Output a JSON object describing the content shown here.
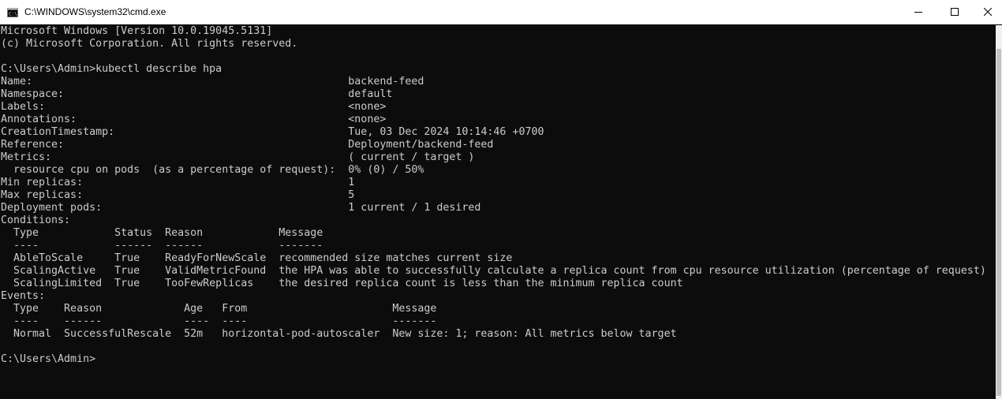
{
  "window": {
    "title": "C:\\WINDOWS\\system32\\cmd.exe",
    "app_icon": "cmd-icon",
    "controls": {
      "minimize_icon": "minimize-icon",
      "maximize_icon": "maximize-icon",
      "close_icon": "close-icon"
    }
  },
  "console": {
    "lines": [
      "Microsoft Windows [Version 10.0.19045.5131]",
      "(c) Microsoft Corporation. All rights reserved.",
      "",
      "C:\\Users\\Admin>kubectl describe hpa",
      "Name:                                                  backend-feed",
      "Namespace:                                             default",
      "Labels:                                                <none>",
      "Annotations:                                           <none>",
      "CreationTimestamp:                                     Tue, 03 Dec 2024 10:14:46 +0700",
      "Reference:                                             Deployment/backend-feed",
      "Metrics:                                               ( current / target )",
      "  resource cpu on pods  (as a percentage of request):  0% (0) / 50%",
      "Min replicas:                                          1",
      "Max replicas:                                          5",
      "Deployment pods:                                       1 current / 1 desired",
      "Conditions:",
      "  Type            Status  Reason            Message",
      "  ----            ------  ------            -------",
      "  AbleToScale     True    ReadyForNewScale  recommended size matches current size",
      "  ScalingActive   True    ValidMetricFound  the HPA was able to successfully calculate a replica count from cpu resource utilization (percentage of request)",
      "  ScalingLimited  True    TooFewReplicas    the desired replica count is less than the minimum replica count",
      "Events:",
      "  Type    Reason             Age   From                       Message",
      "  ----    ------             ----  ----                       -------",
      "  Normal  SuccessfulRescale  52m   horizontal-pod-autoscaler  New size: 1; reason: All metrics below target",
      "",
      "C:\\Users\\Admin>"
    ]
  },
  "colors": {
    "console_bg": "#0c0c0c",
    "console_fg": "#cccccc",
    "titlebar_bg": "#ffffff"
  }
}
